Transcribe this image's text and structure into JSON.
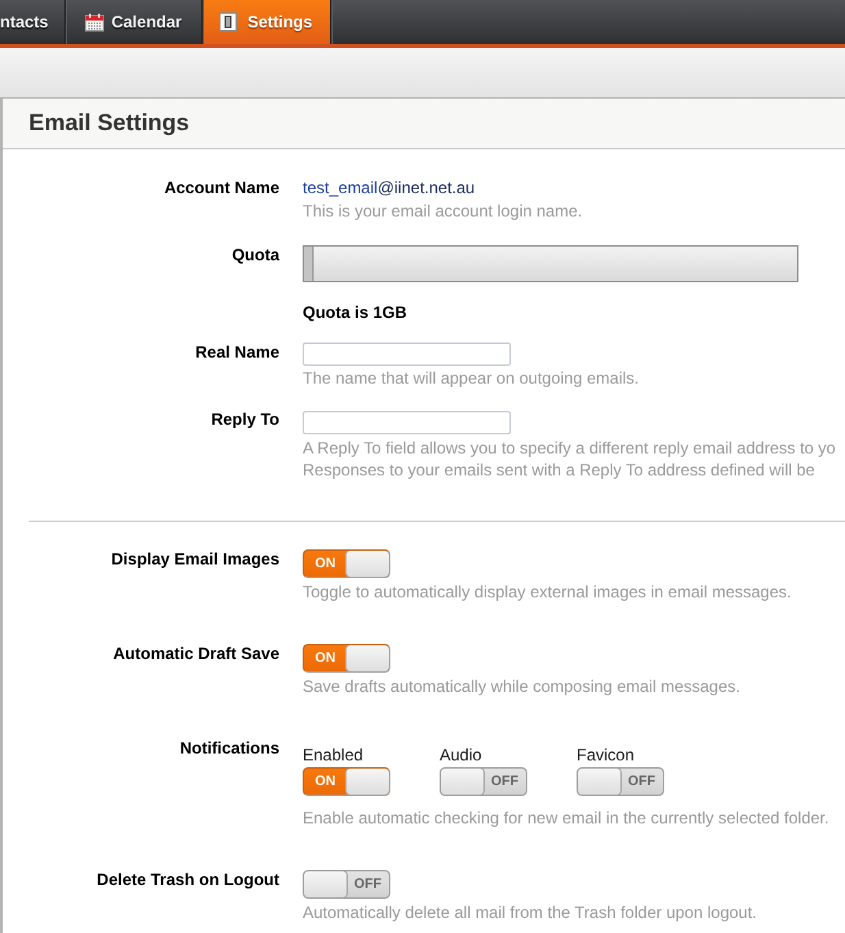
{
  "nav_tabs": [
    {
      "label": "ntacts",
      "selected": false
    },
    {
      "label": "Calendar",
      "selected": false
    },
    {
      "label": "Settings",
      "selected": true
    }
  ],
  "section_title": "Email Settings",
  "account": {
    "label": "Account Name",
    "login": "test_email",
    "domain": "@iinet.net.au",
    "help": "This is your email account login name."
  },
  "quota": {
    "label": "Quota",
    "level": 0.02,
    "caption": "Quota is 1GB"
  },
  "real_name": {
    "label": "Real Name",
    "help": "The name that will appear on outgoing emails."
  },
  "reply_to": {
    "label": "Reply To",
    "help_lines": [
      "A Reply To field allows you to specify a different reply email address to yo",
      "Responses to your emails sent with a Reply To address defined will be"
    ]
  },
  "preferences": [
    {
      "label": "Display Email Images",
      "switches": [
        {
          "on": true,
          "text": "ON"
        }
      ],
      "help": "Toggle to automatically display external images in email messages."
    },
    {
      "label": "Automatic Draft Save",
      "switches": [
        {
          "on": true,
          "text": "ON"
        }
      ],
      "help": "Save drafts automatically while composing email messages."
    },
    {
      "label": "Notifications",
      "switches": [
        {
          "caption": "Enabled",
          "on": true,
          "text": "ON"
        },
        {
          "caption": "Audio",
          "on": false,
          "text": "OFF"
        },
        {
          "caption": "Favicon",
          "on": false,
          "text": "OFF"
        }
      ],
      "help": "Enable automatic checking for new email in the currently selected folder."
    },
    {
      "label": "Delete Trash on Logout",
      "switches": [
        {
          "on": false,
          "text": "OFF"
        }
      ],
      "help": "Automatically delete all mail from the Trash folder upon logout."
    }
  ]
}
